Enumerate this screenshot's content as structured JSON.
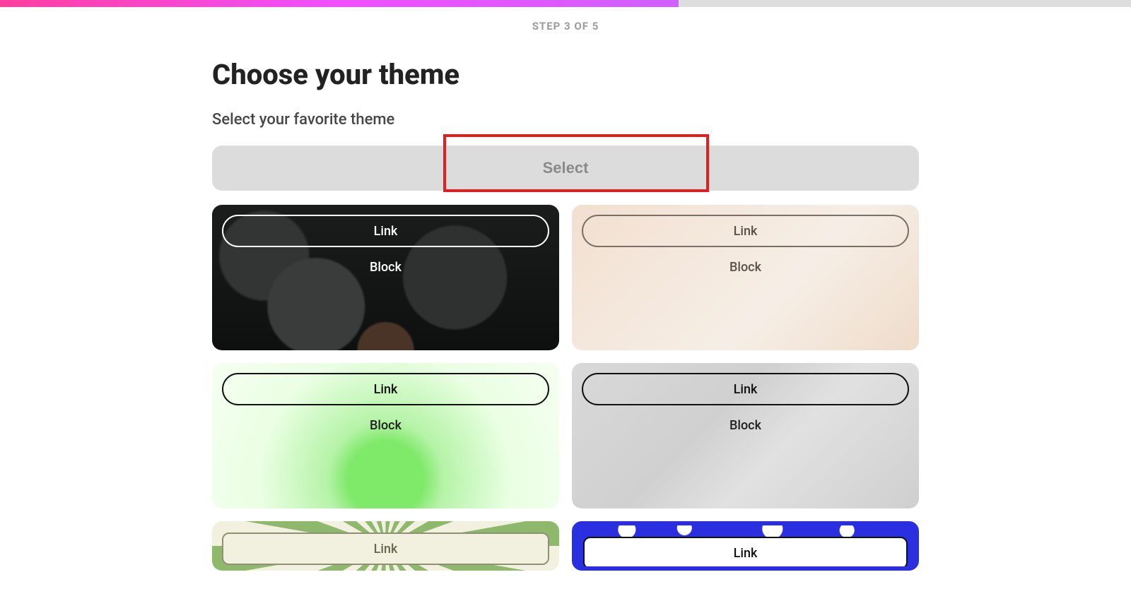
{
  "progress": {
    "current": 3,
    "total": 5,
    "label": "STEP 3 OF 5",
    "percent": 60
  },
  "title": "Choose your theme",
  "subtitle": "Select your favorite theme",
  "selectButton": {
    "label": "Select"
  },
  "linkLabel": "Link",
  "blockLabel": "Block",
  "themes": [
    {
      "id": "dark-bokeh",
      "link": "Link",
      "block": "Block"
    },
    {
      "id": "beige-soft",
      "link": "Link",
      "block": "Block"
    },
    {
      "id": "green-glow",
      "link": "Link",
      "block": "Block"
    },
    {
      "id": "grey-paper",
      "link": "Link",
      "block": "Block"
    },
    {
      "id": "retro-sunburst",
      "link": "Link"
    },
    {
      "id": "blue-daisies",
      "link": "Link"
    }
  ],
  "highlight": {
    "target": "select-button"
  }
}
